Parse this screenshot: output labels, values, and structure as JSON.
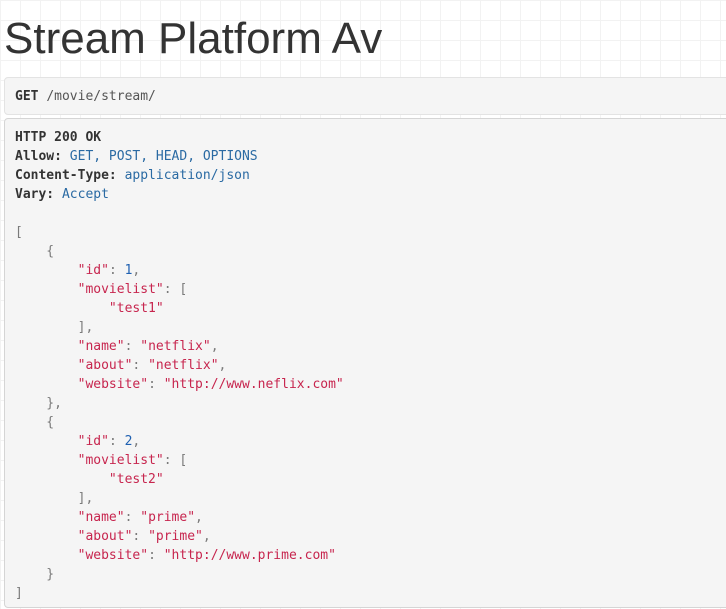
{
  "page": {
    "title": "Stream Platform Av"
  },
  "request": {
    "method": "GET",
    "path": "/movie/stream/"
  },
  "response": {
    "status": "HTTP 200 OK",
    "headers": [
      {
        "name": "Allow:",
        "value": "GET, POST, HEAD, OPTIONS"
      },
      {
        "name": "Content-Type:",
        "value": "application/json"
      },
      {
        "name": "Vary:",
        "value": "Accept"
      }
    ],
    "items": [
      {
        "id": "1",
        "movielist": [
          "\"test1\""
        ],
        "name": "\"netflix\"",
        "about": "\"netflix\"",
        "website": "\"http://www.neflix.com\""
      },
      {
        "id": "2",
        "movielist": [
          "\"test2\""
        ],
        "name": "\"prime\"",
        "about": "\"prime\"",
        "website": "\"http://www.prime.com\""
      }
    ],
    "keys": {
      "id": "\"id\"",
      "movielist": "\"movielist\"",
      "name": "\"name\"",
      "about": "\"about\"",
      "website": "\"website\""
    }
  },
  "colors": {
    "key": "#c7254e",
    "header_value": "#2a6aa3",
    "panel_bg": "#f5f5f5"
  }
}
